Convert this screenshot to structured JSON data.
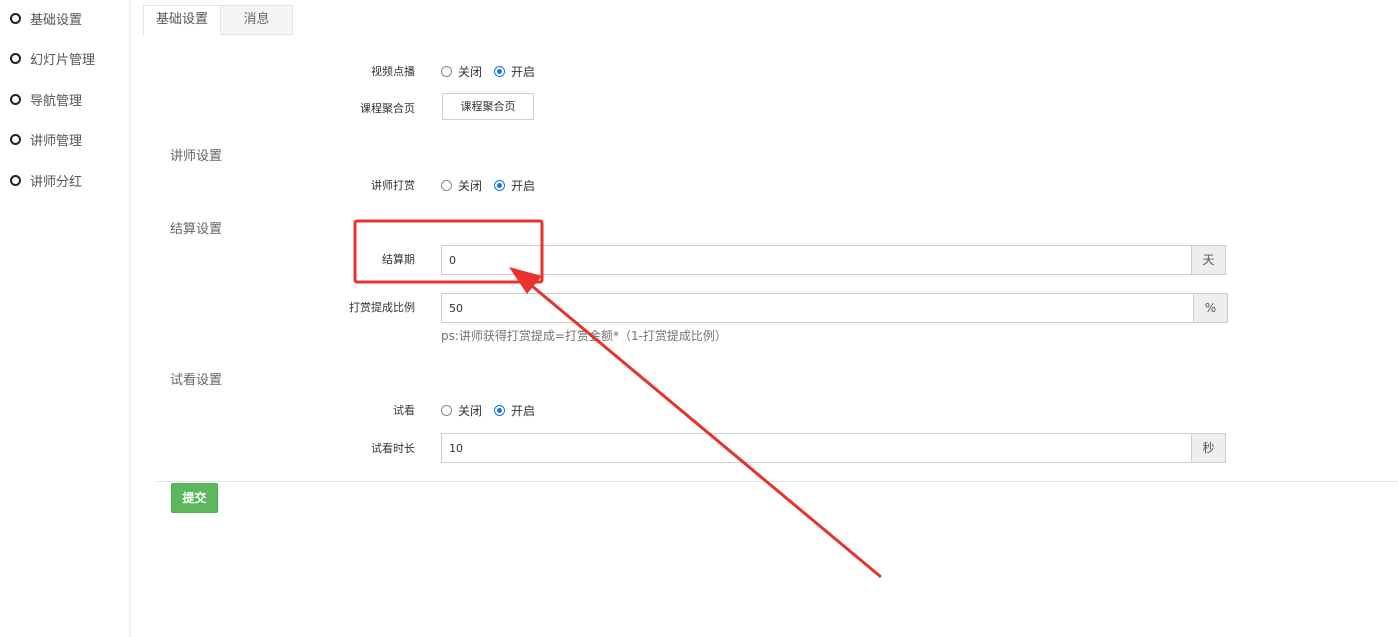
{
  "sidebar": {
    "items": [
      {
        "label": "基础设置"
      },
      {
        "label": "幻灯片管理"
      },
      {
        "label": "导航管理"
      },
      {
        "label": "讲师管理"
      },
      {
        "label": "讲师分红"
      }
    ]
  },
  "tabs": [
    {
      "label": "基础设置",
      "active": true
    },
    {
      "label": "消息",
      "active": false
    }
  ],
  "form": {
    "video_on_demand": {
      "label": "视频点播",
      "off": "关闭",
      "on": "开启",
      "selected": "on"
    },
    "course_page": {
      "label": "课程聚合页",
      "button": "课程聚合页"
    },
    "lecturer_section": "讲师设置",
    "lecturer_reward": {
      "label": "讲师打赏",
      "off": "关闭",
      "on": "开启",
      "selected": "on"
    },
    "settlement_section": "结算设置",
    "settlement_period": {
      "label": "结算期",
      "value": "0",
      "unit": "天"
    },
    "reward_ratio": {
      "label": "打赏提成比例",
      "value": "50",
      "unit": "%"
    },
    "reward_hint": "ps:讲师获得打赏提成=打赏金额*（1-打赏提成比例）",
    "trial_section": "试看设置",
    "trial": {
      "label": "试看",
      "off": "关闭",
      "on": "开启",
      "selected": "on"
    },
    "trial_duration": {
      "label": "试看时长",
      "value": "10",
      "unit": "秒"
    },
    "submit": "提交"
  },
  "colors": {
    "annotation_red": "#e8322b",
    "submit_green": "#5cb85c",
    "radio_blue": "#1a73e8"
  }
}
